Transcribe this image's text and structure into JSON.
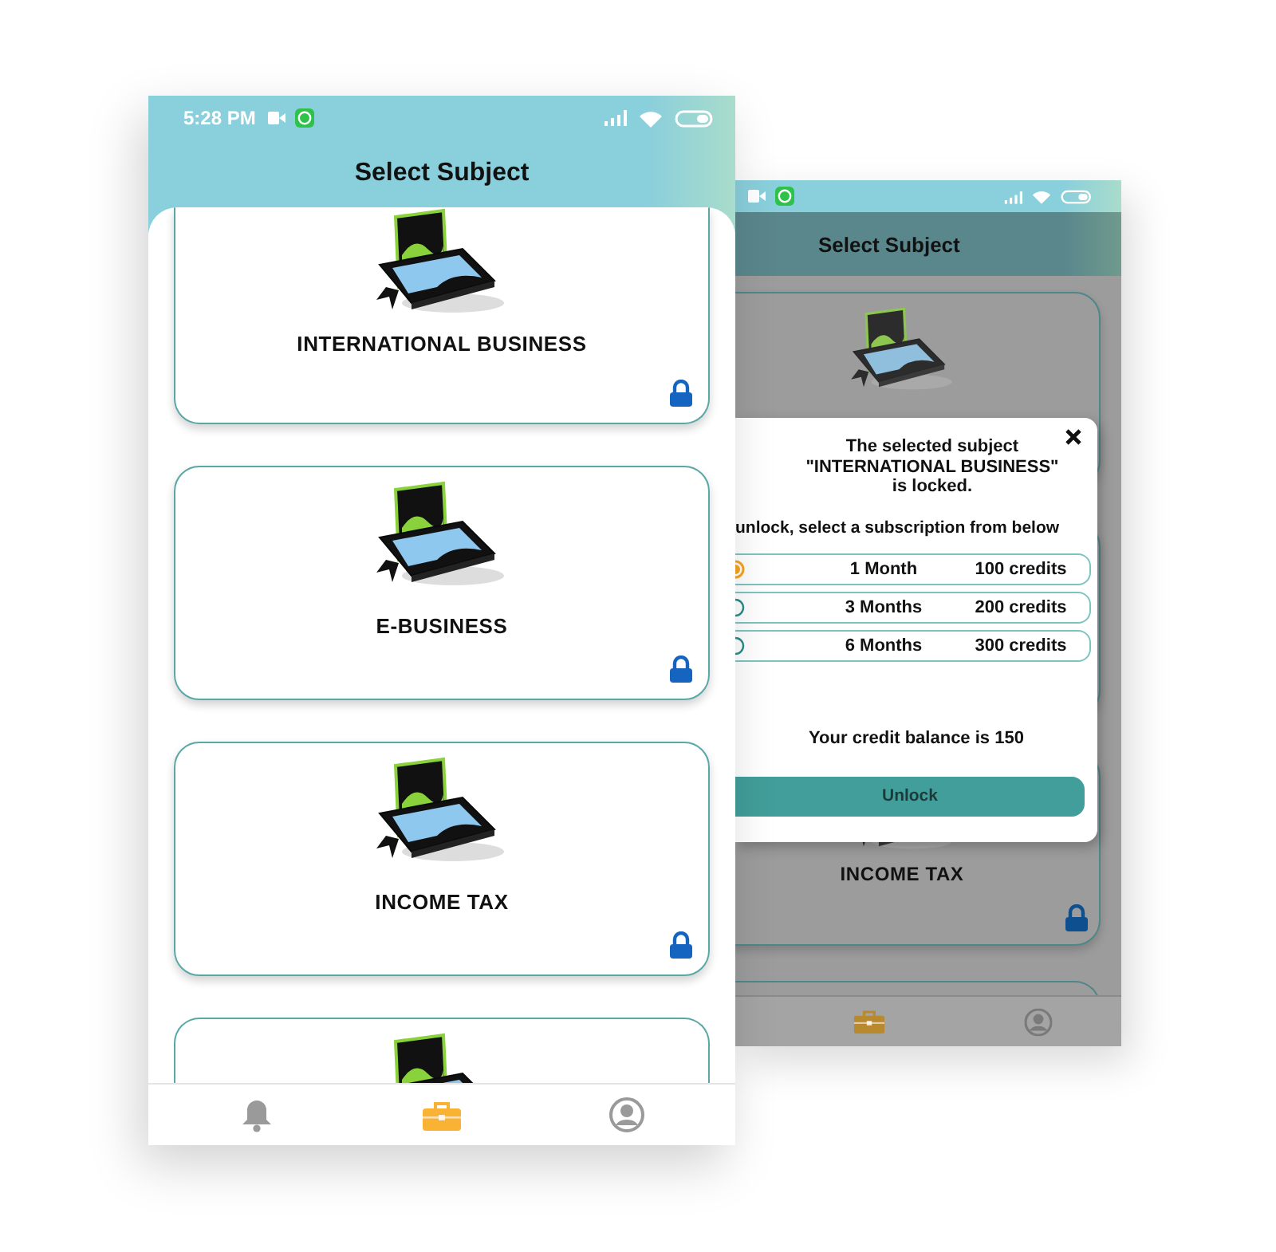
{
  "front_screen": {
    "status_bar": {
      "time": "5:28 PM"
    },
    "title": "Select Subject",
    "subjects": [
      {
        "kind": "full",
        "name": "INTERNATIONAL BUSINESS",
        "locked": true
      },
      {
        "kind": "full",
        "name": "E-BUSINESS",
        "locked": true
      },
      {
        "kind": "full",
        "name": "INCOME TAX",
        "locked": true
      },
      {
        "kind": "partial"
      }
    ],
    "nav": [
      {
        "kind": "bell",
        "selected": false
      },
      {
        "kind": "briefcase",
        "selected": true
      },
      {
        "kind": "profile",
        "selected": false
      }
    ]
  },
  "back_screen": {
    "title": "Select Subject",
    "subjects": [
      {
        "kind": "covered"
      },
      {
        "kind": "hidden"
      },
      {
        "kind": "full",
        "name": "INCOME TAX",
        "locked": true
      },
      {
        "kind": "edge"
      }
    ],
    "nav": [
      {
        "kind": "briefcase",
        "selected": true
      },
      {
        "kind": "profile",
        "selected": false
      }
    ],
    "dialog": {
      "message": "The selected subject\n\"INTERNATIONAL BUSINESS\"\nis locked.",
      "prompt": "unlock, select a subscription from below",
      "options": [
        {
          "duration": "1 Month",
          "credits": "100 credits",
          "selected": true
        },
        {
          "duration": "3 Months",
          "credits": "200 credits",
          "selected": false
        },
        {
          "duration": "6 Months",
          "credits": "300 credits",
          "selected": false
        }
      ],
      "balance": "Your credit balance is 150",
      "button": "Unlock"
    }
  }
}
